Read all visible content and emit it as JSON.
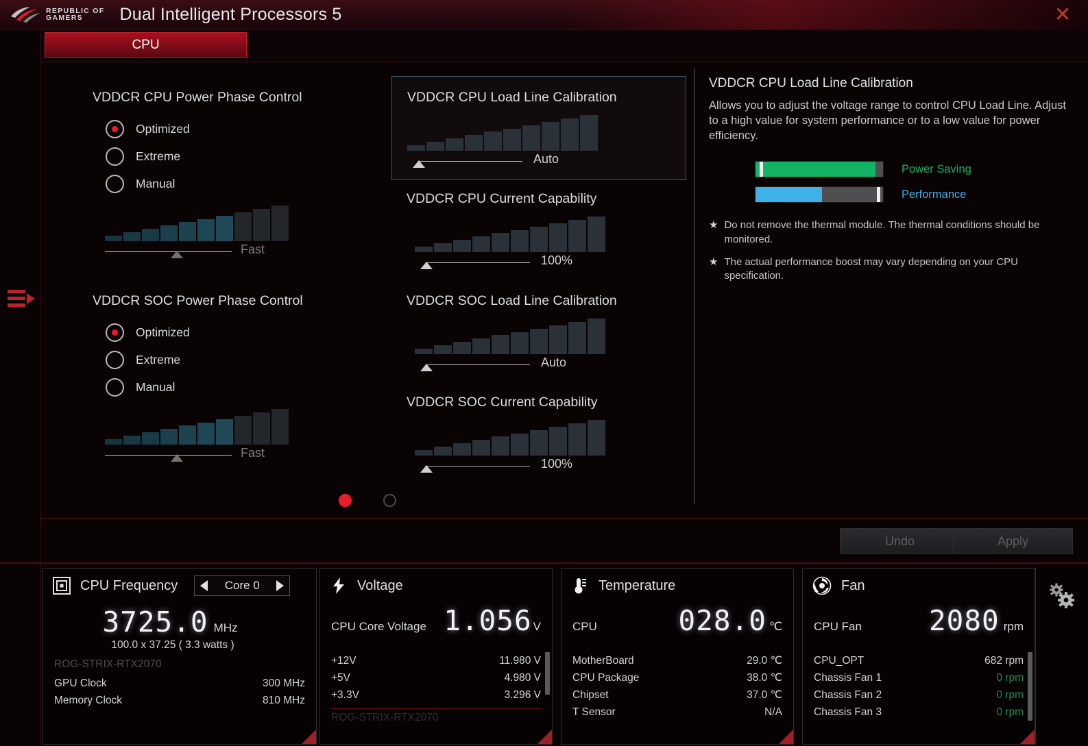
{
  "titlebar": {
    "brand_line1": "REPUBLIC OF",
    "brand_line2": "GAMERS",
    "title": "Dual Intelligent Processors 5",
    "close_label": "✕"
  },
  "tabs": [
    {
      "label": "CPU",
      "active": true
    }
  ],
  "main": {
    "cpu_power_phase": {
      "title": "VDDCR CPU Power Phase Control",
      "options": [
        {
          "label": "Optimized",
          "selected": true
        },
        {
          "label": "Extreme",
          "selected": false
        },
        {
          "label": "Manual",
          "selected": false
        }
      ],
      "slider_value": "Fast"
    },
    "soc_power_phase": {
      "title": "VDDCR SOC Power Phase Control",
      "options": [
        {
          "label": "Optimized",
          "selected": true
        },
        {
          "label": "Extreme",
          "selected": false
        },
        {
          "label": "Manual",
          "selected": false
        }
      ],
      "slider_value": "Fast"
    },
    "cpu_load_line": {
      "title": "VDDCR CPU Load Line Calibration",
      "slider_value": "Auto",
      "highlighted": true
    },
    "cpu_current_cap": {
      "title": "VDDCR CPU Current Capability",
      "slider_value": "100%"
    },
    "soc_load_line": {
      "title": "VDDCR SOC Load Line Calibration",
      "slider_value": "Auto"
    },
    "soc_current_cap": {
      "title": "VDDCR SOC Current Capability",
      "slider_value": "100%"
    },
    "pager": {
      "pages": 2,
      "active_index": 0
    }
  },
  "info_panel": {
    "title": "VDDCR CPU Load Line Calibration",
    "description": "Allows you to adjust the voltage range to control CPU Load Line. Adjust to a high value for system performance or to a low value for power efficiency.",
    "meters": [
      {
        "label": "Power Saving",
        "fill_percent": 94,
        "marker_percent": 3,
        "color": "#12b365",
        "label_color": "#12b365"
      },
      {
        "label": "Performance",
        "fill_percent": 52,
        "marker_percent": 96,
        "color": "#3fb0e8",
        "label_color": "#3fb0e8"
      }
    ],
    "notes": [
      "Do not remove the thermal module. The thermal conditions should be monitored.",
      "The actual performance boost may vary depending on your CPU specification."
    ],
    "star": "★"
  },
  "actions": {
    "undo_label": "Undo",
    "apply_label": "Apply"
  },
  "monitor": {
    "cpu_frequency": {
      "icon": "square-frame-icon",
      "title": "CPU Frequency",
      "core_selector": "Core 0",
      "big_value": "3725.0",
      "big_unit": "MHz",
      "detail": "100.0  x  37.25 ( 3.3     watts )",
      "device_name": "ROG-STRIX-RTX2070",
      "rows": [
        {
          "key": "GPU Clock",
          "value": "300 MHz"
        },
        {
          "key": "Memory Clock",
          "value": "810 MHz"
        }
      ]
    },
    "voltage": {
      "icon": "lightning-bolt-icon",
      "title": "Voltage",
      "primary_label": "CPU Core Voltage",
      "big_value": "1.056",
      "big_unit": "V",
      "rows": [
        {
          "key": "+12V",
          "value": "11.980  V"
        },
        {
          "key": "+5V",
          "value": "4.980  V"
        },
        {
          "key": "+3.3V",
          "value": "3.296  V"
        }
      ],
      "cut_off_text": "ROG-STRIX-RTX2070"
    },
    "temperature": {
      "icon": "thermometer-icon",
      "title": "Temperature",
      "primary_label": "CPU",
      "big_value": "028.0",
      "big_unit": "℃",
      "rows": [
        {
          "key": "MotherBoard",
          "value": "29.0 ℃"
        },
        {
          "key": "CPU Package",
          "value": "38.0 ℃"
        },
        {
          "key": "Chipset",
          "value": "37.0 ℃"
        },
        {
          "key": "T Sensor",
          "value": "N/A"
        }
      ]
    },
    "fan": {
      "icon": "fan-icon",
      "title": "Fan",
      "primary_label": "CPU Fan",
      "big_value": "2080",
      "big_unit": "rpm",
      "rows": [
        {
          "key": "CPU_OPT",
          "value": "682  rpm",
          "green": false
        },
        {
          "key": "Chassis Fan 1",
          "value": "0  rpm",
          "green": true
        },
        {
          "key": "Chassis Fan 2",
          "value": "0  rpm",
          "green": true
        },
        {
          "key": "Chassis Fan 3",
          "value": "0  rpm",
          "green": true
        }
      ]
    },
    "settings": {
      "icon": "gears-icon"
    }
  },
  "theme": {
    "accent_red": "#e81f2a",
    "bar_teal": "#1f4a5c",
    "bar_gray": "#2a3139",
    "green": "#12b365",
    "blue": "#3fb0e8"
  }
}
